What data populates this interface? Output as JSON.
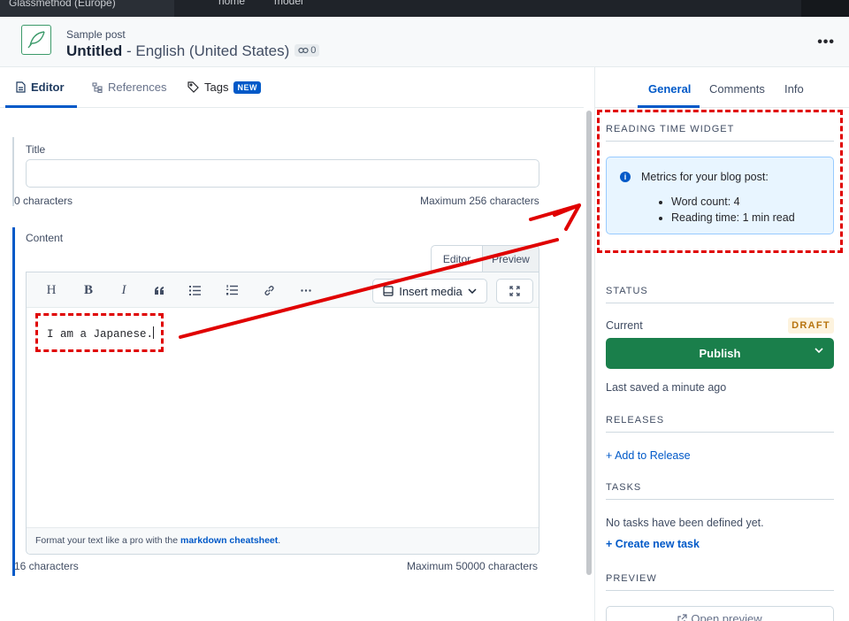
{
  "topbar": {
    "space_label": "Glassmethod (Europe)",
    "crumbs": [
      "home",
      "model"
    ]
  },
  "entry": {
    "content_type": "Sample post",
    "title": "Untitled",
    "locale": " - English (United States)",
    "references_count": "0",
    "more_label": "•••"
  },
  "left_tabs": [
    {
      "label": "Editor",
      "icon": "document-icon"
    },
    {
      "label": "References",
      "icon": "references-icon"
    },
    {
      "label": "Tags",
      "icon": "tag-icon",
      "badge": "NEW"
    }
  ],
  "fields": {
    "title": {
      "label": "Title",
      "value": "",
      "count": "0 characters",
      "max": "Maximum 256 characters"
    },
    "content": {
      "label": "Content",
      "mode_tabs": [
        "Editor",
        "Preview"
      ],
      "toolbar": [
        "H",
        "B",
        "I",
        "quote-icon",
        "bullet-list-icon",
        "numbered-list-icon",
        "link-icon",
        "more-icon"
      ],
      "insert_media": "Insert media",
      "value": "I am a Japanese.",
      "footer_prefix": "Format your text like a pro with the ",
      "footer_link": "markdown cheatsheet",
      "footer_suffix": ".",
      "count": "16 characters",
      "max": "Maximum 50000 characters"
    }
  },
  "sidebar": {
    "tabs": [
      "General",
      "Comments",
      "Info"
    ],
    "reading_widget": {
      "title": "READING TIME WIDGET",
      "message": "Metrics for your blog post:",
      "items": [
        "Word count: 4",
        "Reading time: 1 min read"
      ]
    },
    "status": {
      "title": "STATUS",
      "current_label": "Current",
      "badge": "DRAFT",
      "publish_label": "Publish",
      "last_saved": "Last saved a minute ago"
    },
    "releases": {
      "title": "RELEASES",
      "add_label": "+ Add to Release"
    },
    "tasks": {
      "title": "TASKS",
      "empty": "No tasks have been defined yet.",
      "create_label": "+  Create new task"
    },
    "preview": {
      "title": "PREVIEW",
      "open_label": "Open preview"
    }
  },
  "colors": {
    "accent": "#0059c8",
    "publish": "#1a7f4b",
    "annotation": "#e00000"
  }
}
